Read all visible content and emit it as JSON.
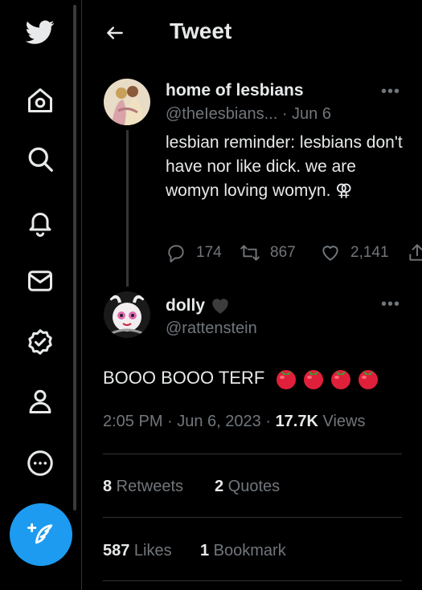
{
  "header": {
    "title": "Tweet"
  },
  "quoted_tweet": {
    "display_name": "home of lesbians",
    "handle": "@theIesbians...",
    "date": "· Jun 6",
    "text": "lesbian reminder: lesbians don't have nor like dick. we are womyn loving womyn. ⚢",
    "replies": "174",
    "retweets": "867",
    "likes": "2,141"
  },
  "main_tweet": {
    "display_name": "dolly",
    "handle": "@rattenstein",
    "text": "BOOO BOOO TERF",
    "time": "2:05 PM · Jun 6, 2023 · ",
    "views_count": "17.7K",
    "views_label": " Views",
    "retweets_count": "8",
    "retweets_label": " Retweets",
    "quotes_count": "2",
    "quotes_label": " Quotes",
    "likes_count": "587",
    "likes_label": " Likes",
    "bookmarks_count": "1",
    "bookmarks_label": " Bookmark"
  },
  "more_label": "•••",
  "colors": {
    "accent": "#1d9bf0",
    "background": "#000000",
    "muted": "#71767b",
    "tomato": "#e0203a"
  },
  "icons": [
    "twitter-logo-icon",
    "home-icon",
    "search-icon",
    "bell-icon",
    "mail-icon",
    "verified-icon",
    "profile-icon",
    "more-circle-icon",
    "compose-icon",
    "back-arrow-icon",
    "reply-icon",
    "retweet-icon",
    "like-icon",
    "share-icon",
    "heart-black-icon",
    "tomato-icon"
  ]
}
